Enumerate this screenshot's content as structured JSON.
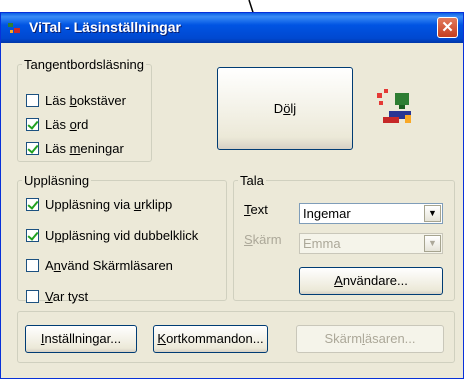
{
  "window": {
    "title": "ViTal - Läsinställningar",
    "close_glyph": "✕"
  },
  "tangent": {
    "legend": "Tangentbordsläsning",
    "items": [
      {
        "pre": "Läs ",
        "u": "b",
        "post": "okstäver",
        "checked": false
      },
      {
        "pre": "Läs ",
        "u": "o",
        "post": "rd",
        "checked": true
      },
      {
        "pre": "Läs ",
        "u": "m",
        "post": "eningar",
        "checked": true
      }
    ]
  },
  "dolj": {
    "pre": "D",
    "u": "ö",
    "post": "lj"
  },
  "upplasning": {
    "legend": "Uppläsning",
    "items": [
      {
        "pre": "Uppläsning via ",
        "u": "u",
        "post": "rklipp",
        "checked": true
      },
      {
        "pre": "U",
        "u": "p",
        "post": "pläsning vid dubbelklick",
        "checked": true
      },
      {
        "pre": "A",
        "u": "n",
        "post": "vänd Skärmläsaren",
        "checked": false
      },
      {
        "pre": "",
        "u": "V",
        "post": "ar tyst",
        "checked": false
      }
    ]
  },
  "tala": {
    "legend": "Tala",
    "text_label": {
      "pre": "",
      "u": "T",
      "post": "ext"
    },
    "text_value": "Ingemar",
    "skarm_label": {
      "pre": "",
      "u": "S",
      "post": "kärm"
    },
    "skarm_value": "Emma",
    "anvandare": {
      "pre": "",
      "u": "A",
      "post": "nvändare..."
    }
  },
  "bottom": {
    "installningar": {
      "pre": "",
      "u": "I",
      "post": "nställningar..."
    },
    "kortkommandon": {
      "pre": "",
      "u": "K",
      "post": "ortkommandon..."
    },
    "skarmlasaren": {
      "pre": "Skärm",
      "u": "l",
      "post": "äsaren..."
    }
  },
  "colors": {
    "title_bar": "#0054e3",
    "dialog_bg": "#ece9d8",
    "close": "#c43d1f",
    "arrow": "#000000"
  }
}
